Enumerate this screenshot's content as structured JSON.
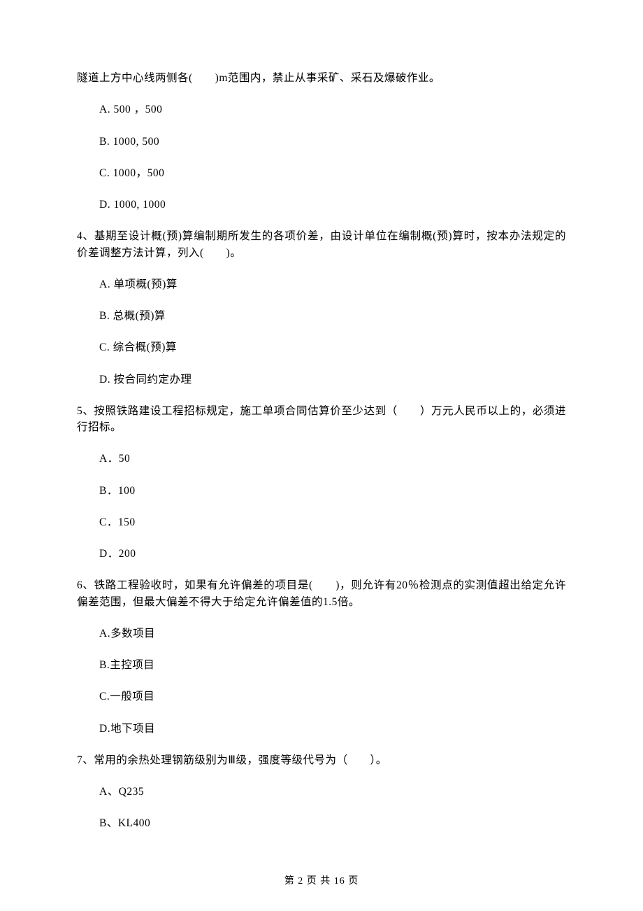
{
  "q3_partial": "隧道上方中心线两侧各(　　)m范围内，禁止从事采矿、采石及爆破作业。",
  "q3": {
    "a": "A. 500 ，500",
    "b": "B. 1000, 500",
    "c": "C. 1000，500",
    "d": "D. 1000, 1000"
  },
  "q4": {
    "text": "4、基期至设计概(预)算编制期所发生的各项价差，由设计单位在编制概(预)算时，按本办法规定的价差调整方法计算，列入(　　)。",
    "a": "A. 单项概(预)算",
    "b": "B. 总概(预)算",
    "c": "C. 综合概(预)算",
    "d": "D. 按合同约定办理"
  },
  "q5": {
    "text": "5、按照铁路建设工程招标规定，施工单项合同估算价至少达到（　　）万元人民币以上的，必须进行招标。",
    "a": "A．50",
    "b": "B．100",
    "c": "C．150",
    "d": "D．200"
  },
  "q6": {
    "text": "6、铁路工程验收时，如果有允许偏差的项目是(　　)，则允许有20％检测点的实测值超出给定允许偏差范围，但最大偏差不得大于给定允许偏差值的1.5倍。",
    "a": "A.多数项目",
    "b": "B.主控项目",
    "c": "C.一般项目",
    "d": "D.地下项目"
  },
  "q7": {
    "text": "7、常用的余热处理钢筋级别为Ⅲ级，强度等级代号为（　　）。",
    "a": "A、Q235",
    "b": "B、KL400"
  },
  "footer": "第 2 页 共 16 页"
}
